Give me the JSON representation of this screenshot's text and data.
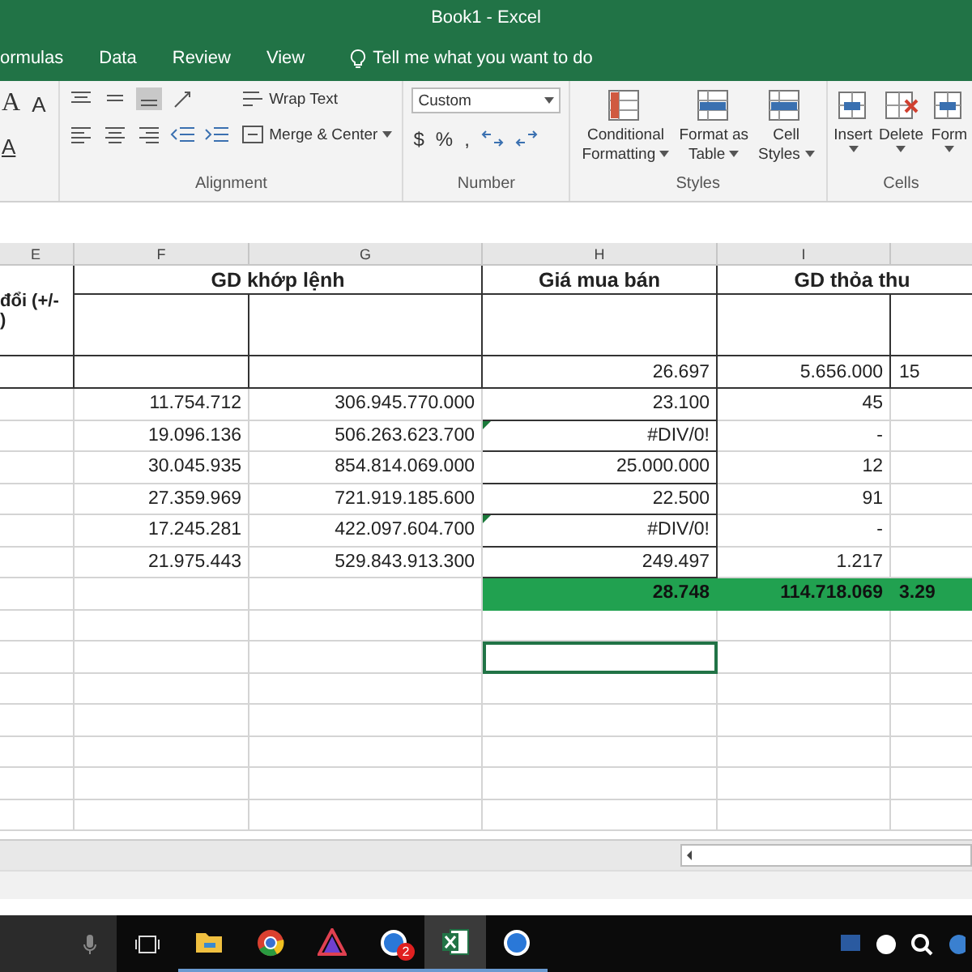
{
  "window": {
    "title": "Book1 - Excel"
  },
  "menu_tabs": [
    {
      "label": "ormulas",
      "selected": false
    },
    {
      "label": "Data",
      "selected": false
    },
    {
      "label": "Review",
      "selected": false
    },
    {
      "label": "View",
      "selected": false
    }
  ],
  "tell_me": {
    "placeholder": "Tell me what you want to do"
  },
  "ribbon": {
    "font": {
      "grow_font": "A",
      "shrink_font": "A",
      "font_color": "A"
    },
    "alignment": {
      "label": "Alignment",
      "wrap_text": "Wrap Text",
      "merge_center": "Merge & Center"
    },
    "number": {
      "label": "Number",
      "format": "Custom",
      "currency": "$",
      "percent": "%",
      "comma": ","
    },
    "styles": {
      "label": "Styles",
      "buttons": [
        {
          "line1": "Conditional",
          "line2": "Formatting"
        },
        {
          "line1": "Format as",
          "line2": "Table"
        },
        {
          "line1": "Cell",
          "line2": "Styles"
        }
      ]
    },
    "cells": {
      "label": "Cells",
      "buttons": [
        "Insert",
        "Delete",
        "Form"
      ]
    }
  },
  "sheet": {
    "column_headers": [
      "E",
      "F",
      "G",
      "H",
      "I"
    ],
    "header": {
      "change_lines": [
        "đổi (+/-",
        ")"
      ],
      "matched": "GD khớp lệnh",
      "price": "Giá mua bán",
      "negotiated": "GD thỏa thu"
    },
    "rows": [
      {
        "kind": "lead",
        "cells": [
          "",
          "",
          "",
          "26.697",
          "5.656.000",
          "15"
        ],
        "flagged": false,
        "selected": false
      },
      {
        "kind": "data",
        "cells": [
          "",
          "11.754.712",
          "306.945.770.000",
          "23.100",
          "45",
          ""
        ],
        "flagged": false,
        "selected": false
      },
      {
        "kind": "data",
        "cells": [
          "",
          "19.096.136",
          "506.263.623.700",
          "#DIV/0!",
          "-",
          ""
        ],
        "flagged": true,
        "selected": false
      },
      {
        "kind": "data",
        "cells": [
          "",
          "30.045.935",
          "854.814.069.000",
          "25.000.000",
          "12",
          ""
        ],
        "flagged": false,
        "selected": false
      },
      {
        "kind": "data",
        "cells": [
          "",
          "27.359.969",
          "721.919.185.600",
          "22.500",
          "91",
          ""
        ],
        "flagged": false,
        "selected": false
      },
      {
        "kind": "data",
        "cells": [
          "",
          "17.245.281",
          "422.097.604.700",
          "#DIV/0!",
          "-",
          ""
        ],
        "flagged": true,
        "selected": false
      },
      {
        "kind": "data",
        "cells": [
          "",
          "21.975.443",
          "529.843.913.300",
          "249.497",
          "1.217",
          ""
        ],
        "flagged": false,
        "selected": false
      },
      {
        "kind": "total",
        "cells": [
          "",
          "",
          "",
          "28.748",
          "114.718.069",
          "3.29"
        ],
        "flagged": false,
        "selected": false
      },
      {
        "kind": "empty",
        "cells": [
          "",
          "",
          "",
          "",
          "",
          ""
        ],
        "flagged": false,
        "selected": false
      },
      {
        "kind": "empty",
        "cells": [
          "",
          "",
          "",
          "",
          "",
          ""
        ],
        "flagged": false,
        "selected": true
      },
      {
        "kind": "empty",
        "cells": [
          "",
          "",
          "",
          "",
          "",
          ""
        ],
        "flagged": false,
        "selected": false
      },
      {
        "kind": "empty",
        "cells": [
          "",
          "",
          "",
          "",
          "",
          ""
        ],
        "flagged": false,
        "selected": false
      },
      {
        "kind": "empty",
        "cells": [
          "",
          "",
          "",
          "",
          "",
          ""
        ],
        "flagged": false,
        "selected": false
      },
      {
        "kind": "empty",
        "cells": [
          "",
          "",
          "",
          "",
          "",
          ""
        ],
        "flagged": false,
        "selected": false
      },
      {
        "kind": "empty",
        "cells": [
          "",
          "",
          "",
          "",
          "",
          ""
        ],
        "flagged": false,
        "selected": false
      }
    ]
  },
  "taskbar": {
    "apps": [
      {
        "kind": "folder",
        "selected": false
      },
      {
        "kind": "browser",
        "selected": false
      },
      {
        "kind": "triangle",
        "selected": false
      },
      {
        "kind": "chat",
        "selected": false,
        "badge": "2"
      },
      {
        "kind": "excel",
        "selected": true
      },
      {
        "kind": "chat",
        "selected": false
      }
    ]
  }
}
